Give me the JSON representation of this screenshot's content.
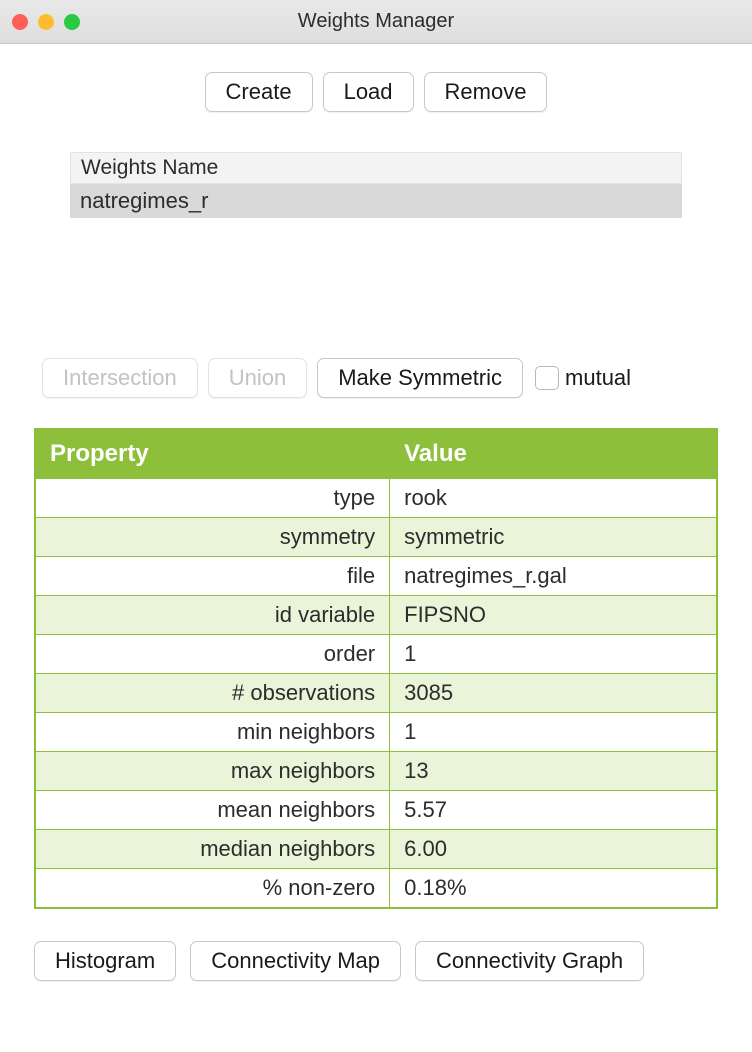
{
  "window": {
    "title": "Weights Manager"
  },
  "toolbar": {
    "create": "Create",
    "load": "Load",
    "remove": "Remove"
  },
  "weights_list": {
    "header": "Weights Name",
    "items": [
      "natregimes_r"
    ]
  },
  "ops": {
    "intersection": "Intersection",
    "union": "Union",
    "make_symmetric": "Make Symmetric",
    "mutual_label": "mutual"
  },
  "props_table": {
    "header_property": "Property",
    "header_value": "Value",
    "rows": [
      {
        "name": "type",
        "value": "rook"
      },
      {
        "name": "symmetry",
        "value": "symmetric"
      },
      {
        "name": "file",
        "value": "natregimes_r.gal"
      },
      {
        "name": "id variable",
        "value": "FIPSNO"
      },
      {
        "name": "order",
        "value": "1"
      },
      {
        "name": "# observations",
        "value": "3085"
      },
      {
        "name": "min neighbors",
        "value": "1"
      },
      {
        "name": "max neighbors",
        "value": "13"
      },
      {
        "name": "mean neighbors",
        "value": "5.57"
      },
      {
        "name": "median neighbors",
        "value": "6.00"
      },
      {
        "name": "% non-zero",
        "value": "0.18%"
      }
    ]
  },
  "bottom": {
    "histogram": "Histogram",
    "connectivity_map": "Connectivity Map",
    "connectivity_graph": "Connectivity Graph"
  }
}
